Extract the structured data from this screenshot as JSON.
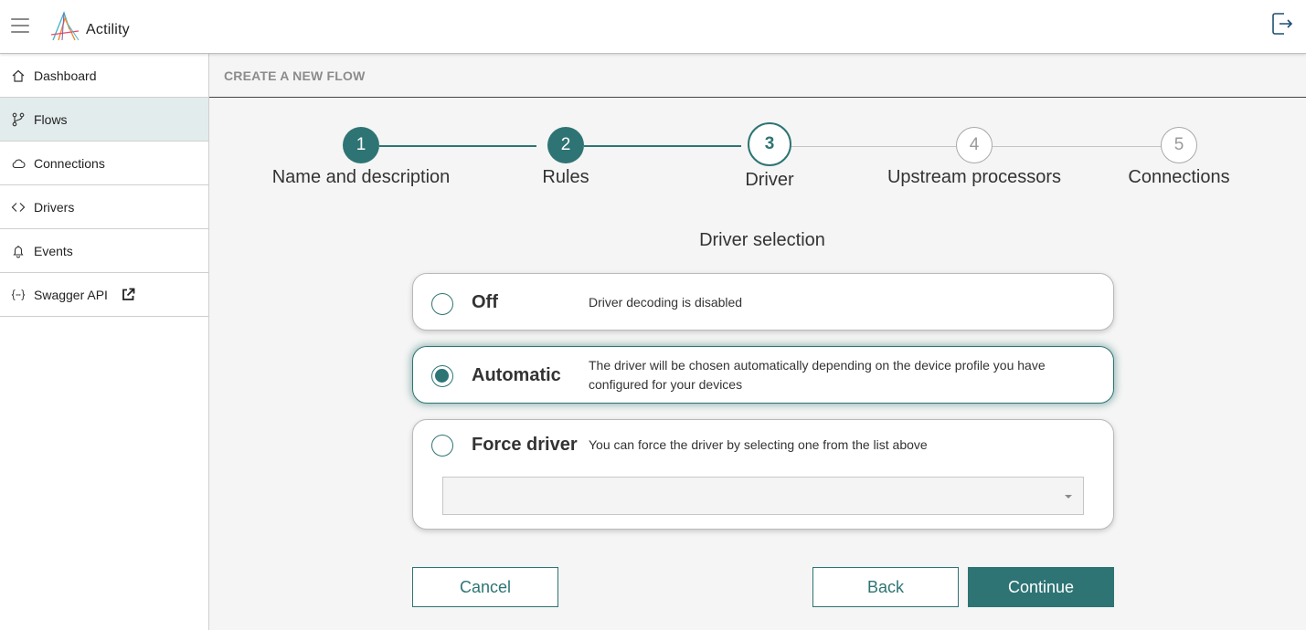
{
  "header": {
    "brand": "Actility",
    "menu_icon": "hamburger-menu-icon",
    "logout_icon": "logout-icon"
  },
  "sidebar": {
    "items": [
      {
        "label": "Dashboard",
        "icon": "home-icon"
      },
      {
        "label": "Flows",
        "icon": "branch-icon",
        "active": true
      },
      {
        "label": "Connections",
        "icon": "cloud-icon"
      },
      {
        "label": "Drivers",
        "icon": "code-icon"
      },
      {
        "label": "Events",
        "icon": "bell-icon"
      },
      {
        "label": "Swagger API",
        "icon": "braces-icon",
        "external_icon": "external-link-icon"
      }
    ]
  },
  "page": {
    "title": "CREATE A NEW FLOW"
  },
  "stepper": {
    "steps": [
      {
        "number": "1",
        "label": "Name and description",
        "state": "done"
      },
      {
        "number": "2",
        "label": "Rules",
        "state": "done"
      },
      {
        "number": "3",
        "label": "Driver",
        "state": "current"
      },
      {
        "number": "4",
        "label": "Upstream processors",
        "state": "todo"
      },
      {
        "number": "5",
        "label": "Connections",
        "state": "todo"
      }
    ]
  },
  "driver_selection": {
    "title": "Driver selection",
    "options": [
      {
        "title": "Off",
        "description": "Driver decoding is disabled",
        "selected": false
      },
      {
        "title": "Automatic",
        "description": "The driver will be chosen automatically depending on the device profile you have configured for your devices",
        "selected": true
      },
      {
        "title": "Force driver",
        "description": "You can force the driver by selecting one from the list above",
        "selected": false
      }
    ],
    "driver_select_value": ""
  },
  "actions": {
    "cancel": "Cancel",
    "back": "Back",
    "continue": "Continue"
  },
  "colors": {
    "accent": "#2e7474",
    "active_nav_bg": "#e3ecec",
    "main_bg": "#f4f5f4"
  }
}
